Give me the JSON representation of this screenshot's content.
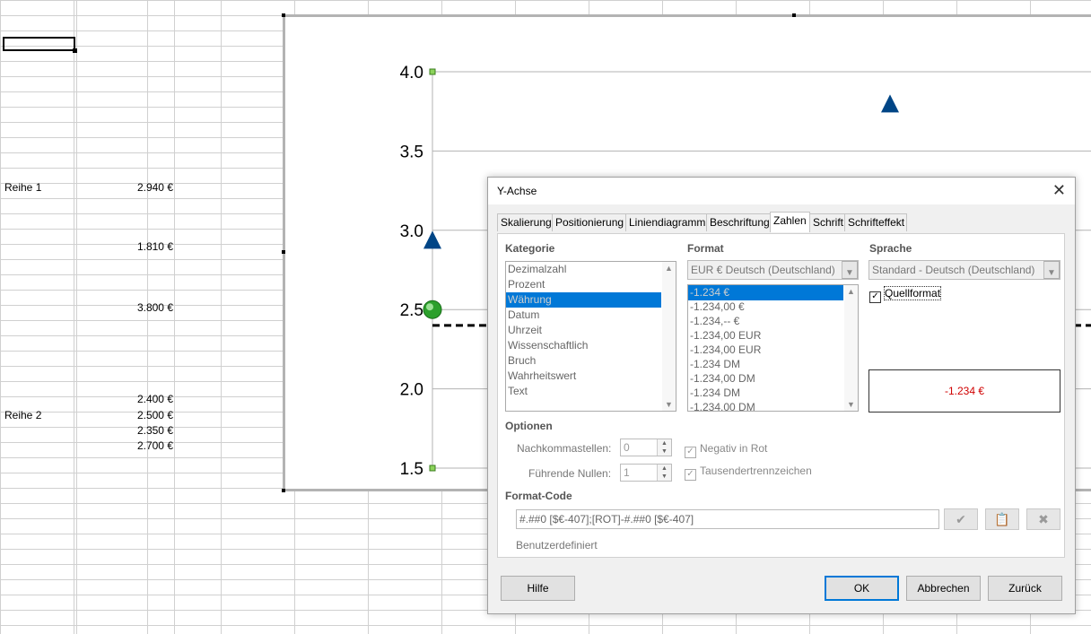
{
  "sheet": {
    "cells": [
      {
        "text": "Reihe 1"
      },
      {
        "text": "2.940 €"
      },
      {
        "text": "1.810 €"
      },
      {
        "text": "3.800 €"
      },
      {
        "text": "2.400 €"
      },
      {
        "text": "Reihe 2"
      },
      {
        "text": "2.500 €"
      },
      {
        "text": "2.350 €"
      },
      {
        "text": "2.700 €"
      }
    ]
  },
  "chart_data": {
    "type": "scatter",
    "yticks": [
      "4.0",
      "3.5",
      "3.0",
      "2.5",
      "2.0",
      "1.5"
    ],
    "ylim": [
      1.5,
      4.0
    ],
    "series": [
      {
        "marker": "triangle",
        "color": "#004586",
        "points": [
          {
            "x": 0,
            "y": 2.94
          },
          {
            "x": 1,
            "y": 3.8
          }
        ]
      },
      {
        "marker": "circle",
        "color": "#2ca02c",
        "points": [
          {
            "x": 0,
            "y": 2.5
          }
        ]
      }
    ],
    "reference_line": {
      "y": 2.4,
      "style": "dashed",
      "color": "#000000"
    }
  },
  "dialog": {
    "title": "Y-Achse",
    "tabs": [
      "Skalierung",
      "Positionierung",
      "Liniendiagramm",
      "Beschriftung",
      "Zahlen",
      "Schrift",
      "Schrifteffekt"
    ],
    "active_tab": "Zahlen",
    "kategorie": {
      "header": "Kategorie",
      "items": [
        "Dezimalzahl",
        "Prozent",
        "Währung",
        "Datum",
        "Uhrzeit",
        "Wissenschaftlich",
        "Bruch",
        "Wahrheitswert",
        "Text"
      ],
      "selected": "Währung"
    },
    "format": {
      "header": "Format",
      "combo_value": "EUR  €  Deutsch (Deutschland)",
      "items": [
        "-1.234 €",
        "-1.234,00 €",
        "-1.234,-- €",
        "-1.234,00 EUR",
        "-1.234,00 EUR",
        "-1.234 DM",
        "-1.234,00 DM",
        "-1.234 DM",
        "-1.234,00 DM"
      ],
      "selected": "-1.234 €"
    },
    "sprache": {
      "header": "Sprache",
      "combo_value": "Standard - Deutsch (Deutschland)",
      "quellformat_label": "Quellformat",
      "quellformat_checked": true
    },
    "preview": "-1.234 €",
    "optionen": {
      "header": "Optionen",
      "nachkommastellen_label": "Nachkommastellen:",
      "nachkommastellen_value": "0",
      "fuehrende_nullen_label": "Führende Nullen:",
      "fuehrende_nullen_value": "1",
      "negativ_rot_label": "Negativ in Rot",
      "tausender_label": "Tausendertrennzeichen"
    },
    "format_code": {
      "header": "Format-Code",
      "value": "#.##0 [$€-407];[ROT]-#.##0 [$€-407]",
      "benutzerdefiniert": "Benutzerdefiniert"
    },
    "buttons": {
      "hilfe": "Hilfe",
      "ok": "OK",
      "abbrechen": "Abbrechen",
      "zurueck": "Zurück"
    }
  }
}
